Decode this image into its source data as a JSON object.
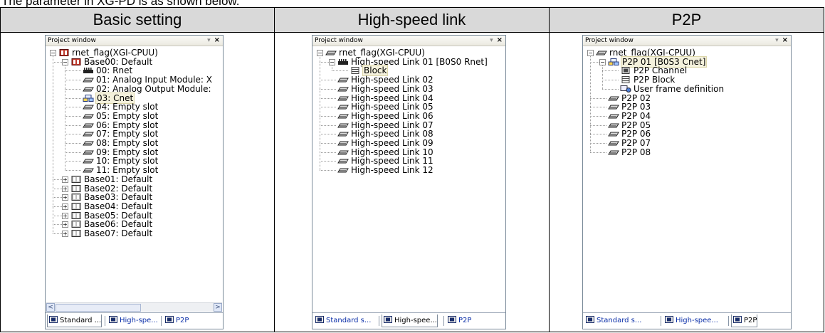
{
  "caption": "The parameter in XG-PD is as shown below.",
  "columns": [
    {
      "header": "Basic setting"
    },
    {
      "header": "High-speed link"
    },
    {
      "header": "P2P"
    }
  ],
  "panels": [
    {
      "title": "Project window",
      "tree": [
        {
          "label": "rnet_flag(XGI-CPUU)",
          "icon": "plc-cpu-icon",
          "expander": "−"
        },
        {
          "label": "Base00: Default",
          "icon": "plc-base-icon",
          "expander": "−"
        },
        {
          "label": "00: Rnet",
          "icon": "comm-module-icon"
        },
        {
          "label": "01: Analog Input Module: X",
          "icon": "io-slot-icon"
        },
        {
          "label": "02: Analog Output Module:",
          "icon": "io-slot-icon"
        },
        {
          "label": "03: Cnet",
          "icon": "network-module-icon",
          "selected": true
        },
        {
          "label": "04: Empty slot",
          "icon": "io-slot-icon"
        },
        {
          "label": "05: Empty slot",
          "icon": "io-slot-icon"
        },
        {
          "label": "06: Empty slot",
          "icon": "io-slot-icon"
        },
        {
          "label": "07: Empty slot",
          "icon": "io-slot-icon"
        },
        {
          "label": "08: Empty slot",
          "icon": "io-slot-icon"
        },
        {
          "label": "09: Empty slot",
          "icon": "io-slot-icon"
        },
        {
          "label": "10: Empty slot",
          "icon": "io-slot-icon"
        },
        {
          "label": "11: Empty slot",
          "icon": "io-slot-icon"
        },
        {
          "label": "Base01: Default",
          "icon": "plc-base-gray-icon",
          "expander": "+"
        },
        {
          "label": "Base02: Default",
          "icon": "plc-base-gray-icon",
          "expander": "+"
        },
        {
          "label": "Base03: Default",
          "icon": "plc-base-gray-icon",
          "expander": "+"
        },
        {
          "label": "Base04: Default",
          "icon": "plc-base-gray-icon",
          "expander": "+"
        },
        {
          "label": "Base05: Default",
          "icon": "plc-base-gray-icon",
          "expander": "+"
        },
        {
          "label": "Base06: Default",
          "icon": "plc-base-gray-icon",
          "expander": "+"
        },
        {
          "label": "Base07: Default",
          "icon": "plc-base-gray-icon",
          "expander": "+"
        }
      ],
      "scrollbar": {
        "left": "<",
        "right": ">"
      },
      "tabs": [
        {
          "label": "Standard ...",
          "active": true
        },
        {
          "label": "High-spe...",
          "active": false
        },
        {
          "label": "P2P",
          "active": false
        }
      ]
    },
    {
      "title": "Project window",
      "tree": [
        {
          "label": "rnet_flag(XGI-CPUU)",
          "icon": "io-slot-icon",
          "expander": "−"
        },
        {
          "label": "High-speed Link 01 [B0S0 Rnet]",
          "icon": "comm-module-icon",
          "expander": "−"
        },
        {
          "label": "Block",
          "icon": "block-icon",
          "selected": true
        },
        {
          "label": "High-speed Link 02",
          "icon": "io-slot-icon"
        },
        {
          "label": "High-speed Link 03",
          "icon": "io-slot-icon"
        },
        {
          "label": "High-speed Link 04",
          "icon": "io-slot-icon"
        },
        {
          "label": "High-speed Link 05",
          "icon": "io-slot-icon"
        },
        {
          "label": "High-speed Link 06",
          "icon": "io-slot-icon"
        },
        {
          "label": "High-speed Link 07",
          "icon": "io-slot-icon"
        },
        {
          "label": "High-speed Link 08",
          "icon": "io-slot-icon"
        },
        {
          "label": "High-speed Link 09",
          "icon": "io-slot-icon"
        },
        {
          "label": "High-speed Link 10",
          "icon": "io-slot-icon"
        },
        {
          "label": "High-speed Link 11",
          "icon": "io-slot-icon"
        },
        {
          "label": "High-speed Link 12",
          "icon": "io-slot-icon"
        }
      ],
      "tabs": [
        {
          "label": "Standard s...",
          "active": false
        },
        {
          "label": "High-spee...",
          "active": true
        },
        {
          "label": "P2P",
          "active": false
        }
      ]
    },
    {
      "title": "Project window",
      "tree": [
        {
          "label": "rnet_flag(XGI-CPUU)",
          "icon": "io-slot-icon",
          "expander": "−"
        },
        {
          "label": "P2P 01 [B0S3 Cnet]",
          "icon": "network-module-icon",
          "expander": "−",
          "selected": true
        },
        {
          "label": "P2P Channel",
          "icon": "channel-icon"
        },
        {
          "label": "P2P Block",
          "icon": "block-icon"
        },
        {
          "label": "User frame definition",
          "icon": "user-frame-icon"
        },
        {
          "label": "P2P 02",
          "icon": "io-slot-icon"
        },
        {
          "label": "P2P 03",
          "icon": "io-slot-icon"
        },
        {
          "label": "P2P 04",
          "icon": "io-slot-icon"
        },
        {
          "label": "P2P 05",
          "icon": "io-slot-icon"
        },
        {
          "label": "P2P 06",
          "icon": "io-slot-icon"
        },
        {
          "label": "P2P 07",
          "icon": "io-slot-icon"
        },
        {
          "label": "P2P 08",
          "icon": "io-slot-icon"
        }
      ],
      "tabs": [
        {
          "label": "Standard s...",
          "active": false
        },
        {
          "label": "High-spee...",
          "active": false
        },
        {
          "label": "P2P",
          "active": true
        }
      ]
    }
  ]
}
